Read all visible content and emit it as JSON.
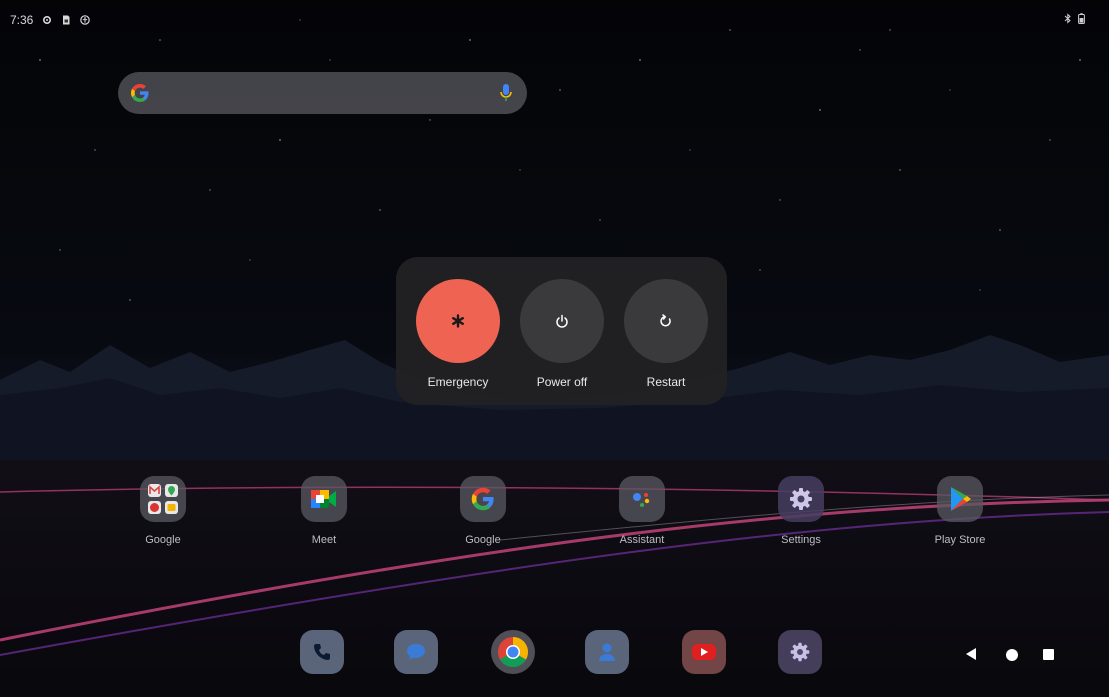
{
  "status_bar": {
    "time": "7:36",
    "icons_left": [
      "settings-icon",
      "sim-card-icon",
      "accessibility-icon"
    ],
    "icons_right": [
      "bluetooth-icon",
      "battery-icon"
    ]
  },
  "search_bar": {
    "logo": "google-g-icon",
    "mic_icon": "mic-icon"
  },
  "power_menu": {
    "buttons": [
      {
        "label": "Emergency",
        "icon": "asterisk-icon",
        "color": "#ef6353"
      },
      {
        "label": "Power off",
        "icon": "power-icon",
        "color": "#3a3a3c"
      },
      {
        "label": "Restart",
        "icon": "restart-icon",
        "color": "#3a3a3c"
      }
    ]
  },
  "apps": [
    {
      "label": "Google",
      "icon": "google-folder-icon"
    },
    {
      "label": "Meet",
      "icon": "meet-icon"
    },
    {
      "label": "Google",
      "icon": "google-icon"
    },
    {
      "label": "Assistant",
      "icon": "assistant-icon"
    },
    {
      "label": "Settings",
      "icon": "settings-icon"
    },
    {
      "label": "Play Store",
      "icon": "play-store-icon"
    }
  ],
  "dock": [
    "phone-icon",
    "messages-icon",
    "chrome-icon",
    "contacts-icon",
    "youtube-icon",
    "settings-icon"
  ],
  "navigation": [
    "back-icon",
    "home-icon",
    "recents-icon"
  ]
}
